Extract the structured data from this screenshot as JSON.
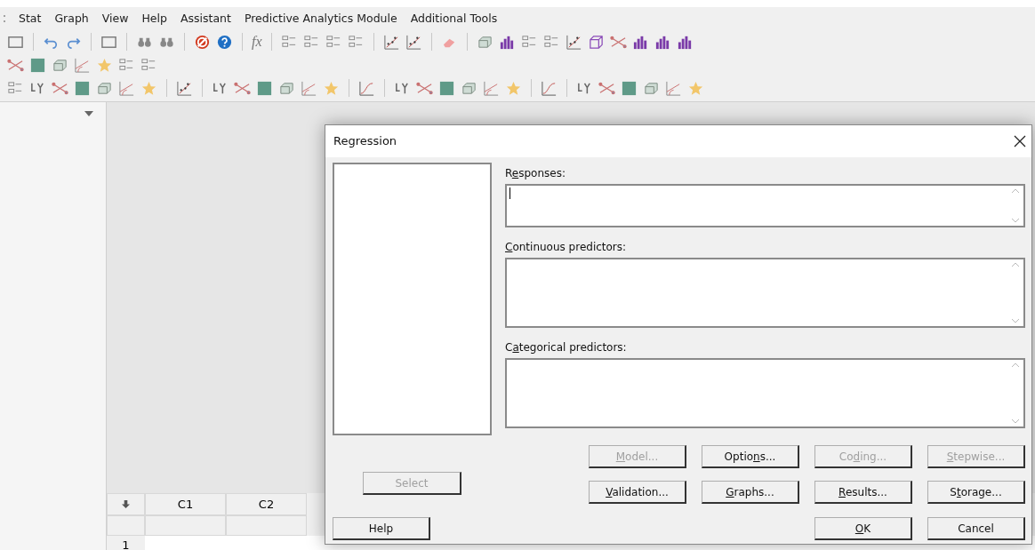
{
  "menu": [
    "Stat",
    "Graph",
    "View",
    "Help",
    "Assistant",
    "Predictive Analytics Module",
    "Additional Tools"
  ],
  "toolbar": {
    "formula_label": "fx"
  },
  "worksheet": {
    "columns": [
      "C1",
      "C2"
    ],
    "rows": [
      "1"
    ]
  },
  "dialog": {
    "title": "Regression",
    "select_button": {
      "label": [
        {
          "text": "Select",
          "underline": false
        }
      ],
      "disabled": true
    },
    "fields": [
      {
        "label": [
          {
            "text": "R",
            "underline": false
          },
          {
            "text": "e",
            "underline": true
          },
          {
            "text": "sponses:",
            "underline": false
          }
        ],
        "focused": true
      },
      {
        "label": [
          {
            "text": "C",
            "underline": true
          },
          {
            "text": "ontinuous predictors:",
            "underline": false
          }
        ],
        "focused": false
      },
      {
        "label": [
          {
            "text": "C",
            "underline": false
          },
          {
            "text": "a",
            "underline": true
          },
          {
            "text": "tegorical predictors:",
            "underline": false
          }
        ],
        "focused": false
      }
    ],
    "buttons": [
      {
        "label": [
          {
            "text": "M",
            "underline": true
          },
          {
            "text": "odel...",
            "underline": false
          }
        ],
        "disabled": true
      },
      {
        "label": [
          {
            "text": "Optio",
            "underline": false
          },
          {
            "text": "n",
            "underline": true
          },
          {
            "text": "s...",
            "underline": false
          }
        ],
        "disabled": false
      },
      {
        "label": [
          {
            "text": "Co",
            "underline": false
          },
          {
            "text": "d",
            "underline": true
          },
          {
            "text": "ing...",
            "underline": false
          }
        ],
        "disabled": true
      },
      {
        "label": [
          {
            "text": "S",
            "underline": true
          },
          {
            "text": "tepwise...",
            "underline": false
          }
        ],
        "disabled": true
      },
      {
        "label": [
          {
            "text": "V",
            "underline": true
          },
          {
            "text": "alidation...",
            "underline": false
          }
        ],
        "disabled": false
      },
      {
        "label": [
          {
            "text": "G",
            "underline": true
          },
          {
            "text": "raphs...",
            "underline": false
          }
        ],
        "disabled": false
      },
      {
        "label": [
          {
            "text": "R",
            "underline": true
          },
          {
            "text": "esults...",
            "underline": false
          }
        ],
        "disabled": false
      },
      {
        "label": [
          {
            "text": "S",
            "underline": false
          },
          {
            "text": "t",
            "underline": true
          },
          {
            "text": "orage...",
            "underline": false
          }
        ],
        "disabled": false
      }
    ],
    "help_button": {
      "label": [
        {
          "text": "Help",
          "underline": false
        }
      ]
    },
    "ok_button": {
      "label": [
        {
          "text": "O",
          "underline": true
        },
        {
          "text": "K",
          "underline": false
        }
      ]
    },
    "cancel_button": {
      "label": [
        {
          "text": "Cancel",
          "underline": false
        }
      ]
    }
  }
}
